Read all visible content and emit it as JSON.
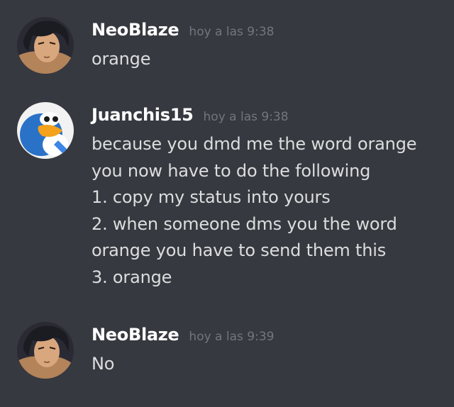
{
  "messages": [
    {
      "username": "NeoBlaze",
      "timestamp": "hoy a las 9:38",
      "avatar": "anime-character-avatar",
      "lines": [
        "orange"
      ]
    },
    {
      "username": "Juanchis15",
      "timestamp": "hoy a las 9:38",
      "avatar": "penguin-avatar",
      "lines": [
        "because you dmd me the word orange",
        "you now have to do the following",
        "1. copy my status into yours",
        "2. when someone dms you the word",
        "orange you have to send them this",
        "3. orange"
      ]
    },
    {
      "username": "NeoBlaze",
      "timestamp": "hoy a las 9:39",
      "avatar": "anime-character-avatar",
      "lines": [
        "No"
      ]
    }
  ],
  "colors": {
    "background": "#36393f",
    "username": "#ffffff",
    "text": "#dcddde",
    "timestamp": "#72767d"
  }
}
